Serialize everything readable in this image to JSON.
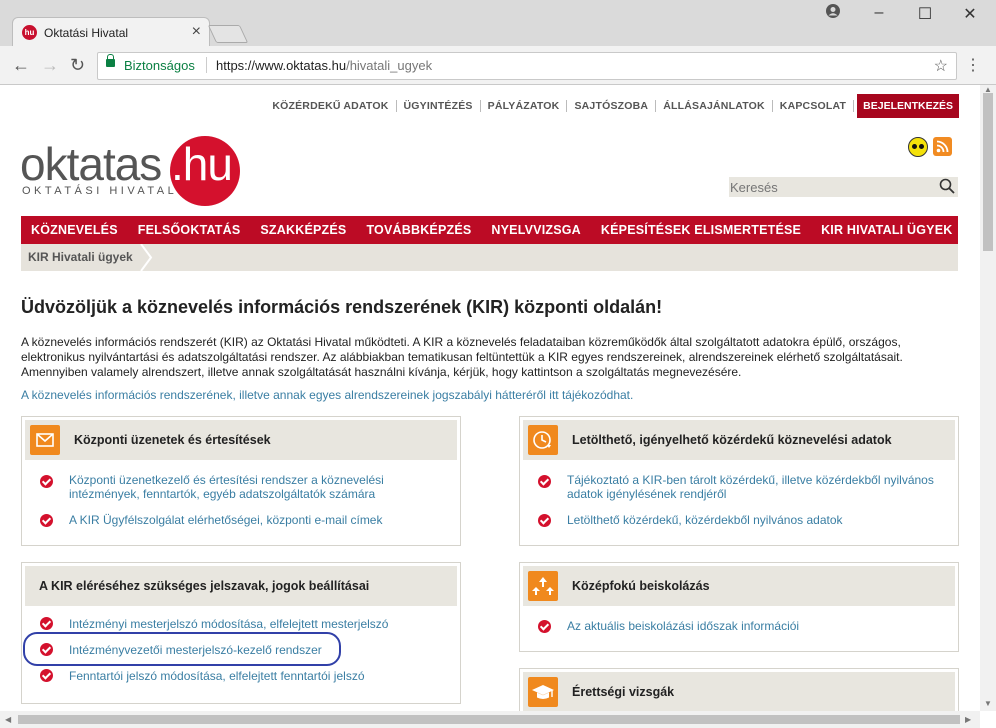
{
  "browser": {
    "tab_title": "Oktatási Hivatal",
    "favicon_text": "hu",
    "secure_label": "Biztonságos",
    "url_domain": "https://www.oktatas.hu",
    "url_path": "/hivatali_ugyek"
  },
  "top_links": [
    "KÖZÉRDEKŰ ADATOK",
    "ÜGYINTÉZÉS",
    "PÁLYÁZATOK",
    "SAJTÓSZOBA",
    "ÁLLÁSAJÁNLATOK",
    "KAPCSOLAT"
  ],
  "login_label": "BEJELENTKEZÉS",
  "logo": {
    "main": "oktatas",
    "hu": ".hu",
    "subtitle": "OKTATÁSI HIVATAL"
  },
  "search": {
    "placeholder": "Keresés"
  },
  "main_nav": [
    "KÖZNEVELÉS",
    "FELSŐOKTATÁS",
    "SZAKKÉPZÉS",
    "TOVÁBBKÉPZÉS",
    "NYELVVIZSGA",
    "KÉPESÍTÉSEK ELISMERTETÉSE",
    "KIR HIVATALI ÜGYEK"
  ],
  "breadcrumb": "KIR Hivatali ügyek",
  "heading": "Üdvözöljük a köznevelés információs rendszerének (KIR) központi oldalán!",
  "intro": "A köznevelés információs rendszerét (KIR) az Oktatási Hivatal működteti. A KIR a köznevelés feladataiban közreműködők által szolgáltatott adatokra épülő, országos, elektronikus nyilvántartási és adatszolgáltatási rendszer. Az alábbiakban tematikusan feltüntettük a KIR egyes rendszereinek, alrendszereinek elérhető szolgáltatásait. Amennyiben valamely alrendszert, illetve annak szolgáltatását használni kívánja, kérjük, hogy kattintson a szolgáltatás megnevezésére.",
  "legal_link": "A köznevelés információs rendszerének, illetve annak egyes alrendszereinek jogszabályi hátteréről itt tájékozódhat.",
  "boxes": {
    "central": {
      "title": "Központi üzenetek és értesítések",
      "items": [
        "Központi üzenetkezelő és értesítési rendszer a köznevelési intézmények, fenntartók, egyéb adatszolgáltatók számára",
        "A KIR Ügyfélszolgálat elérhetőségei, központi e-mail címek"
      ]
    },
    "passwords": {
      "title": "A KIR eléréséhez szükséges jelszavak, jogok beállításai",
      "items": [
        "Intézményi mesterjelszó módosítása, elfelejtett mesterjelszó",
        "Intézményvezetői mesterjelszó-kezelő rendszer",
        "Fenntartói jelszó módosítása, elfelejtett fenntartói jelszó"
      ]
    },
    "downloads": {
      "title": "Letölthető, igényelhető közérdekű köznevelési adatok",
      "items": [
        "Tájékoztató a KIR-ben tárolt közérdekű, illetve közérdekből nyilvános adatok igénylésének rendjéről",
        "Letölthető közérdekű, közérdekből nyilvános adatok"
      ]
    },
    "secondary": {
      "title": "Középfokú beiskolázás",
      "items": [
        "Az aktuális beiskolázási időszak információi"
      ]
    },
    "exams": {
      "title": "Érettségi vizsgák"
    }
  },
  "colors": {
    "brand_red": "#bc0b25",
    "link_blue": "#3a7ea3",
    "icon_orange": "#f0891e",
    "highlight_oval": "#3140a8"
  }
}
